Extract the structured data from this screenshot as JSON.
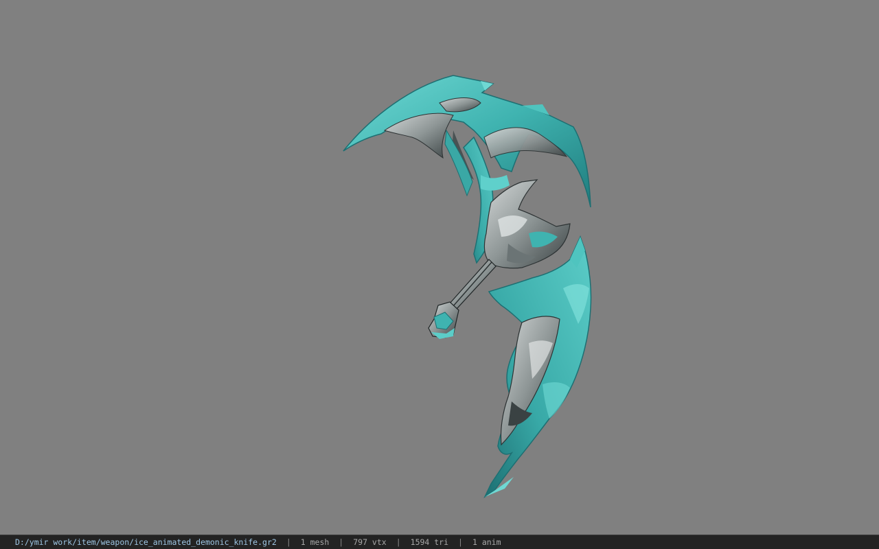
{
  "viewer": {
    "background_color": "#808080",
    "model_name": "ice_animated_demonic_knife",
    "model_colors": {
      "ice": "#3fb3b0",
      "ice_light": "#7fe0da",
      "ice_dark": "#1d6f72",
      "metal": "#b8bcbc",
      "metal_dark": "#2c3233"
    }
  },
  "status": {
    "file_path": "D:/ymir work/item/weapon/ice_animated_demonic_knife.gr2",
    "separator": "|",
    "mesh": "1 mesh",
    "vertices": "797 vtx",
    "triangles": "1594 tri",
    "animations": "1 anim",
    "bar_color": "#232323",
    "path_color": "#9ec6e4"
  }
}
